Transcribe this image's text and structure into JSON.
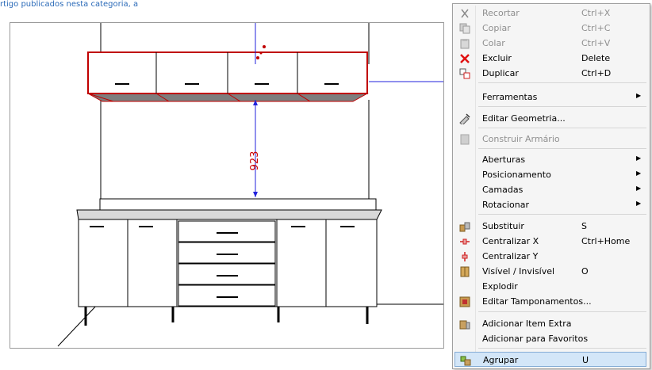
{
  "top_text": "rtigo publicados nesta categoria, a",
  "drawing": {
    "dimension_label": "923"
  },
  "context_menu": {
    "items": [
      {
        "label": "Recortar",
        "shortcut": "Ctrl+X",
        "icon": "scissors-icon",
        "disabled": true
      },
      {
        "label": "Copiar",
        "shortcut": "Ctrl+C",
        "icon": "copy-icon",
        "disabled": true
      },
      {
        "label": "Colar",
        "shortcut": "Ctrl+V",
        "icon": "paste-icon",
        "disabled": true
      },
      {
        "label": "Excluir",
        "shortcut": "Delete",
        "icon": "delete-x-icon",
        "disabled": false
      },
      {
        "label": "Duplicar",
        "shortcut": "Ctrl+D",
        "icon": "duplicate-icon",
        "disabled": false
      },
      {
        "label": "Ferramentas",
        "submenu": true
      },
      {
        "label": "Editar Geometria...",
        "icon": "edit-geometry-icon"
      },
      {
        "label": "Construir Armário",
        "icon": "build-cabinet-icon",
        "disabled": true
      },
      {
        "label": "Aberturas",
        "submenu": true
      },
      {
        "label": "Posicionamento",
        "submenu": true
      },
      {
        "label": "Camadas",
        "submenu": true
      },
      {
        "label": "Rotacionar",
        "submenu": true
      },
      {
        "label": "Substituir",
        "shortcut": "S",
        "icon": "replace-icon"
      },
      {
        "label": "Centralizar X",
        "shortcut": "Ctrl+Home",
        "icon": "center-x-icon"
      },
      {
        "label": "Centralizar Y",
        "icon": "center-y-icon"
      },
      {
        "label": "Visível / Invisível",
        "shortcut": "O",
        "icon": "visibility-icon"
      },
      {
        "label": "Explodir"
      },
      {
        "label": "Editar Tamponamentos...",
        "icon": "edit-tamponamento-icon"
      },
      {
        "label": "Adicionar Item Extra",
        "icon": "add-extra-item-icon"
      },
      {
        "label": "Adicionar para Favoritos"
      },
      {
        "label": "Agrupar",
        "shortcut": "U",
        "icon": "group-icon",
        "highlighted": true
      }
    ]
  }
}
